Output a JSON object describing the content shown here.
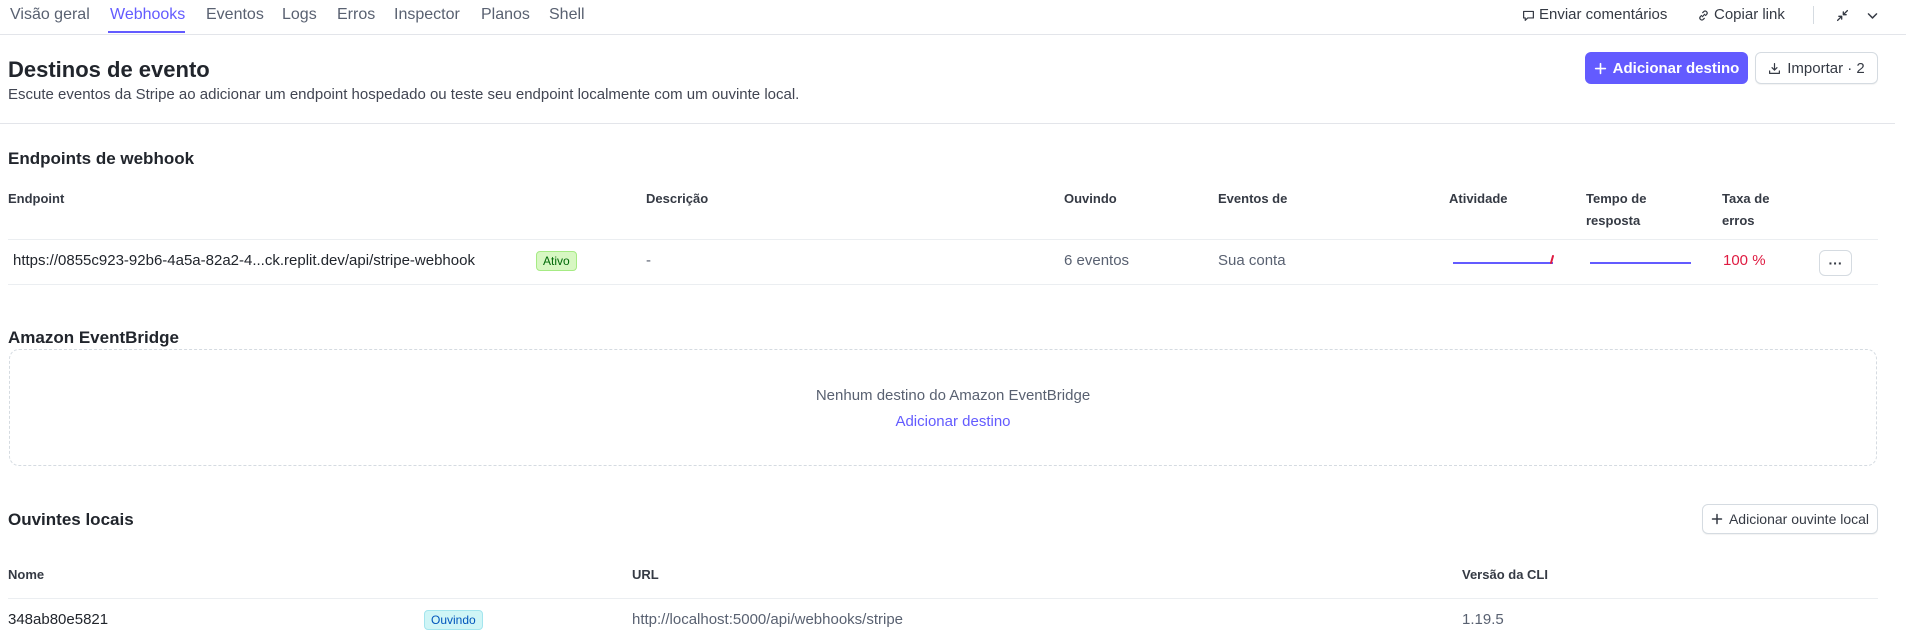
{
  "tabs": [
    {
      "label": "Visão geral"
    },
    {
      "label": "Webhooks"
    },
    {
      "label": "Eventos"
    },
    {
      "label": "Logs"
    },
    {
      "label": "Erros"
    },
    {
      "label": "Inspector"
    },
    {
      "label": "Planos"
    },
    {
      "label": "Shell"
    }
  ],
  "top_actions": {
    "feedback": "Enviar comentários",
    "copy_link": "Copiar link"
  },
  "header": {
    "title": "Destinos de evento",
    "subtitle": "Escute eventos da Stripe ao adicionar um endpoint hospedado ou teste seu endpoint localmente com um ouvinte local.",
    "add_destination": "Adicionar destino",
    "import": "Importar · 2"
  },
  "webhooks": {
    "title": "Endpoints de webhook",
    "columns": {
      "endpoint": "Endpoint",
      "description": "Descrição",
      "listening": "Ouvindo",
      "events_from": "Eventos de",
      "activity": "Atividade",
      "response_time_1": "Tempo de",
      "response_time_2": "resposta",
      "error_rate_1": "Taxa de",
      "error_rate_2": "erros"
    },
    "row": {
      "url": "https://0855c923-92b6-4a5a-82a2-4...ck.replit.dev/api/stripe-webhook",
      "status": "Ativo",
      "description": "-",
      "listening": "6 eventos",
      "events_from": "Sua conta",
      "error_rate": "100 %",
      "more": "···"
    }
  },
  "eventbridge": {
    "title": "Amazon EventBridge",
    "empty_text": "Nenhum destino do Amazon EventBridge",
    "add_link": "Adicionar destino"
  },
  "local_listeners": {
    "title": "Ouvintes locais",
    "add_button": "Adicionar ouvinte local",
    "columns": {
      "name": "Nome",
      "url": "URL",
      "cli_version": "Versão da CLI"
    },
    "row": {
      "name": "348ab80e5821",
      "status": "Ouvindo",
      "url": "http://localhost:5000/api/webhooks/stripe",
      "cli_version": "1.19.5"
    }
  },
  "colors": {
    "accent": "#635bff",
    "error": "#df1b41",
    "success_badge": "#d7f7c2",
    "info_badge": "#cff5f6"
  }
}
